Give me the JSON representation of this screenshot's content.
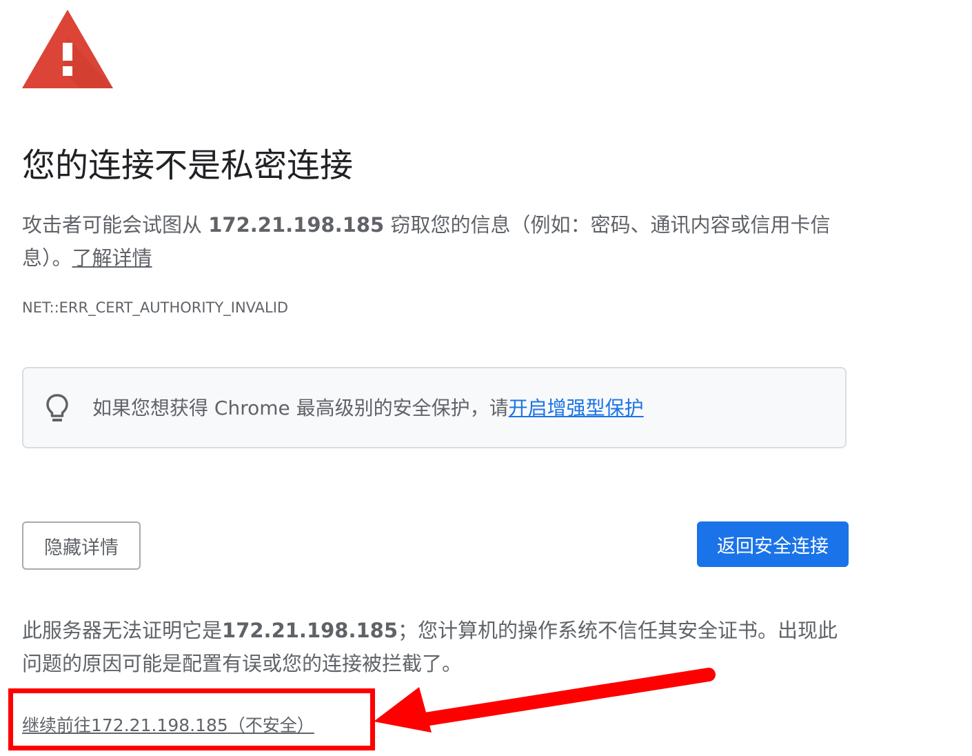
{
  "page": {
    "title": "您的连接不是私密连接",
    "explanation_prefix": "攻击者可能会试图从 ",
    "host": "172.21.198.185",
    "explanation_suffix": " 窃取您的信息（例如：密码、通讯内容或信用卡信息）。",
    "learn_more_label": "了解详情",
    "error_code": "NET::ERR_CERT_AUTHORITY_INVALID"
  },
  "enhanced_protection": {
    "icon": "lightbulb-icon",
    "text": "如果您想获得 Chrome 最高级别的安全保护，请",
    "link_label": "开启增强型保护"
  },
  "buttons": {
    "hide_details_label": "隐藏详情",
    "back_to_safety_label": "返回安全连接"
  },
  "details": {
    "prefix": "此服务器无法证明它是",
    "host": "172.21.198.185",
    "suffix": "；您计算机的操作系统不信任其安全证书。出现此问题的原因可能是配置有误或您的连接被拦截了。",
    "proceed_label": "继续前往172.21.198.185（不安全）"
  },
  "annotation": {
    "color": "#ff0000"
  },
  "colors": {
    "warning_red": "#db4437",
    "primary_blue": "#1a73e8",
    "text_gray": "#5f6368"
  }
}
